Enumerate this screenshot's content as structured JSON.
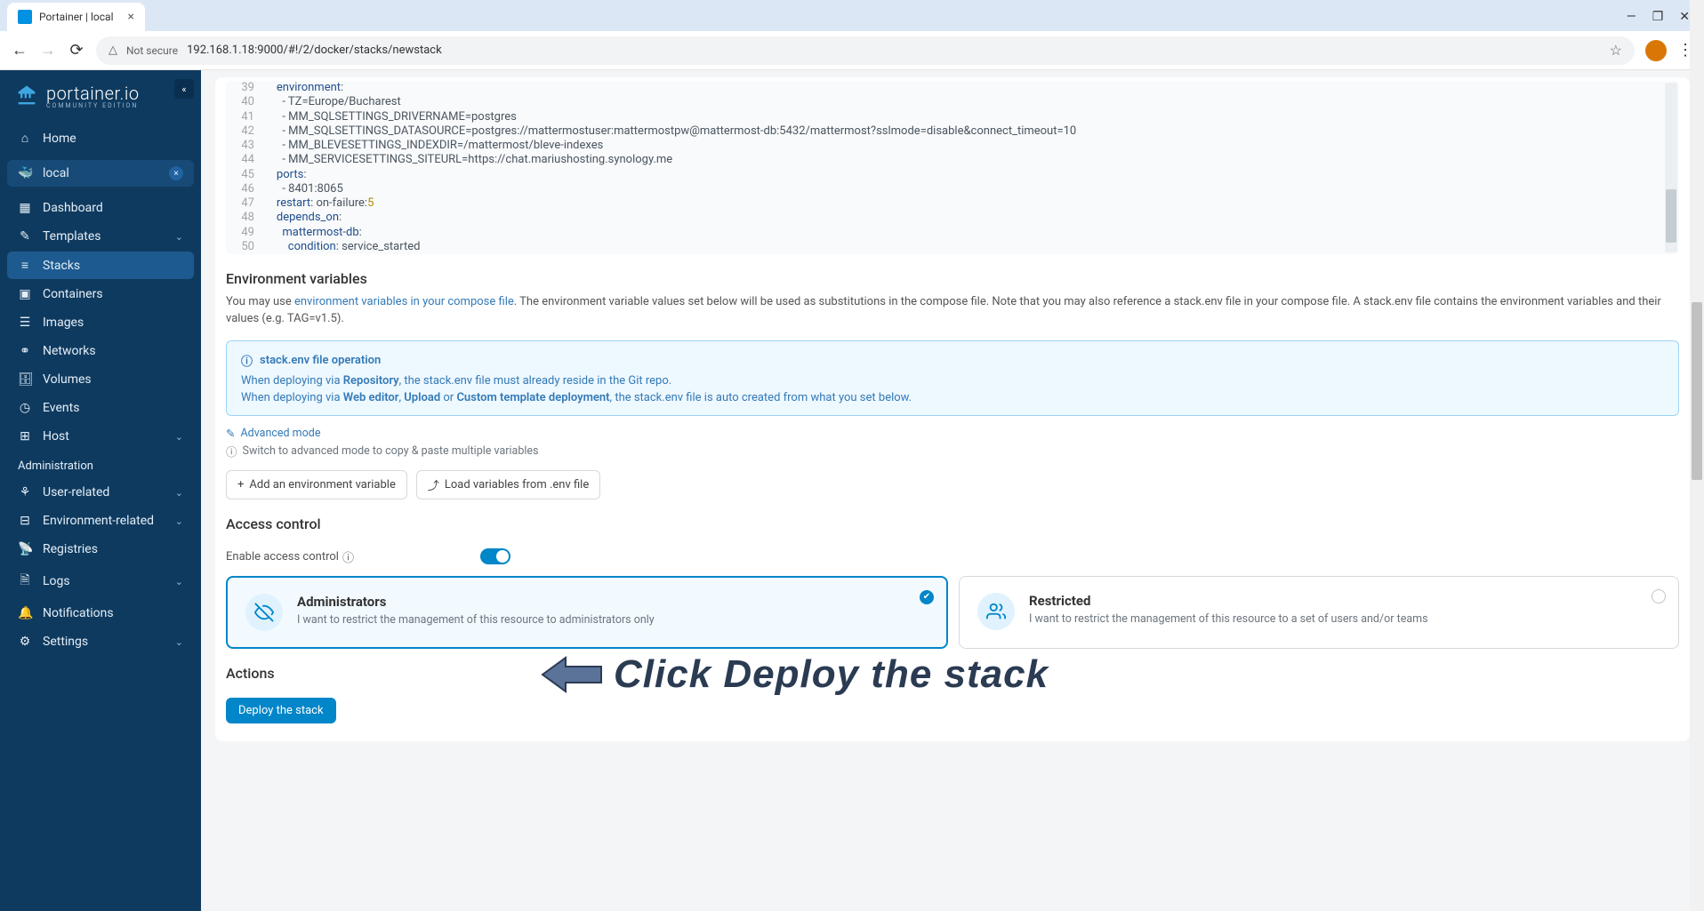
{
  "browser": {
    "tab_title": "Portainer | local",
    "not_secure": "Not secure",
    "url": "192.168.1.18:9000/#!/2/docker/stacks/newstack"
  },
  "sidebar": {
    "brand": "portainer.io",
    "brand_sub": "COMMUNITY EDITION",
    "home": "Home",
    "env_name": "local",
    "items": [
      "Dashboard",
      "Templates",
      "Stacks",
      "Containers",
      "Images",
      "Networks",
      "Volumes",
      "Events",
      "Host"
    ],
    "admin_title": "Administration",
    "admin_items": [
      "User-related",
      "Environment-related",
      "Registries",
      "Logs",
      "Notifications",
      "Settings"
    ]
  },
  "code": {
    "lines": [
      {
        "n": "39",
        "indent": "    ",
        "key": "environment",
        "after": ":"
      },
      {
        "n": "40",
        "indent": "      ",
        "text": "- TZ=Europe/Bucharest"
      },
      {
        "n": "41",
        "indent": "      ",
        "text": "- MM_SQLSETTINGS_DRIVERNAME=postgres"
      },
      {
        "n": "42",
        "indent": "      ",
        "text": "- MM_SQLSETTINGS_DATASOURCE=postgres://mattermostuser:mattermostpw@mattermost-db:5432/mattermost?sslmode=disable&connect_timeout=10"
      },
      {
        "n": "43",
        "indent": "      ",
        "text": "- MM_BLEVESETTINGS_INDEXDIR=/mattermost/bleve-indexes"
      },
      {
        "n": "44",
        "indent": "      ",
        "text": "- MM_SERVICESETTINGS_SITEURL=https://chat.mariushosting.synology.me"
      },
      {
        "n": "45",
        "indent": "    ",
        "key": "ports",
        "after": ":"
      },
      {
        "n": "46",
        "indent": "      ",
        "text": "- 8401:8065"
      },
      {
        "n": "47",
        "indent": "    ",
        "key": "restart",
        "after": ": on-failure:",
        "num": "5"
      },
      {
        "n": "48",
        "indent": "    ",
        "key": "depends_on",
        "after": ":"
      },
      {
        "n": "49",
        "indent": "      ",
        "key": "mattermost-db",
        "after": ":"
      },
      {
        "n": "50",
        "indent": "        ",
        "key": "condition",
        "after": ": service_started"
      }
    ]
  },
  "env": {
    "title": "Environment variables",
    "desc1": "You may use ",
    "desc1_link": "environment variables in your compose file",
    "desc2": ". The environment variable values set below will be used as substitutions in the compose file. Note that you may also reference a stack.env file in your compose file. A stack.env file contains the environment variables and their values (e.g. TAG=v1.5).",
    "box_title": "stack.env file operation",
    "box_line1a": "When deploying via ",
    "box_line1b": "Repository",
    "box_line1c": ", the stack.env file must already reside in the Git repo.",
    "box_line2a": "When deploying via ",
    "box_line2b": "Web editor",
    "box_line2c": ", ",
    "box_line2d": "Upload",
    "box_line2e": " or ",
    "box_line2f": "Custom template deployment",
    "box_line2g": ", the stack.env file is auto created from what you set below.",
    "adv_mode": "Advanced mode",
    "adv_hint": "Switch to advanced mode to copy & paste multiple variables",
    "btn_add": "Add an environment variable",
    "btn_load": "Load variables from .env file"
  },
  "access": {
    "title": "Access control",
    "toggle_label": "Enable access control",
    "card1_title": "Administrators",
    "card1_desc": "I want to restrict the management of this resource to administrators only",
    "card2_title": "Restricted",
    "card2_desc": "I want to restrict the management of this resource to a set of users and/or teams"
  },
  "actions": {
    "title": "Actions",
    "deploy": "Deploy the stack"
  },
  "annotation": "Click Deploy the stack"
}
